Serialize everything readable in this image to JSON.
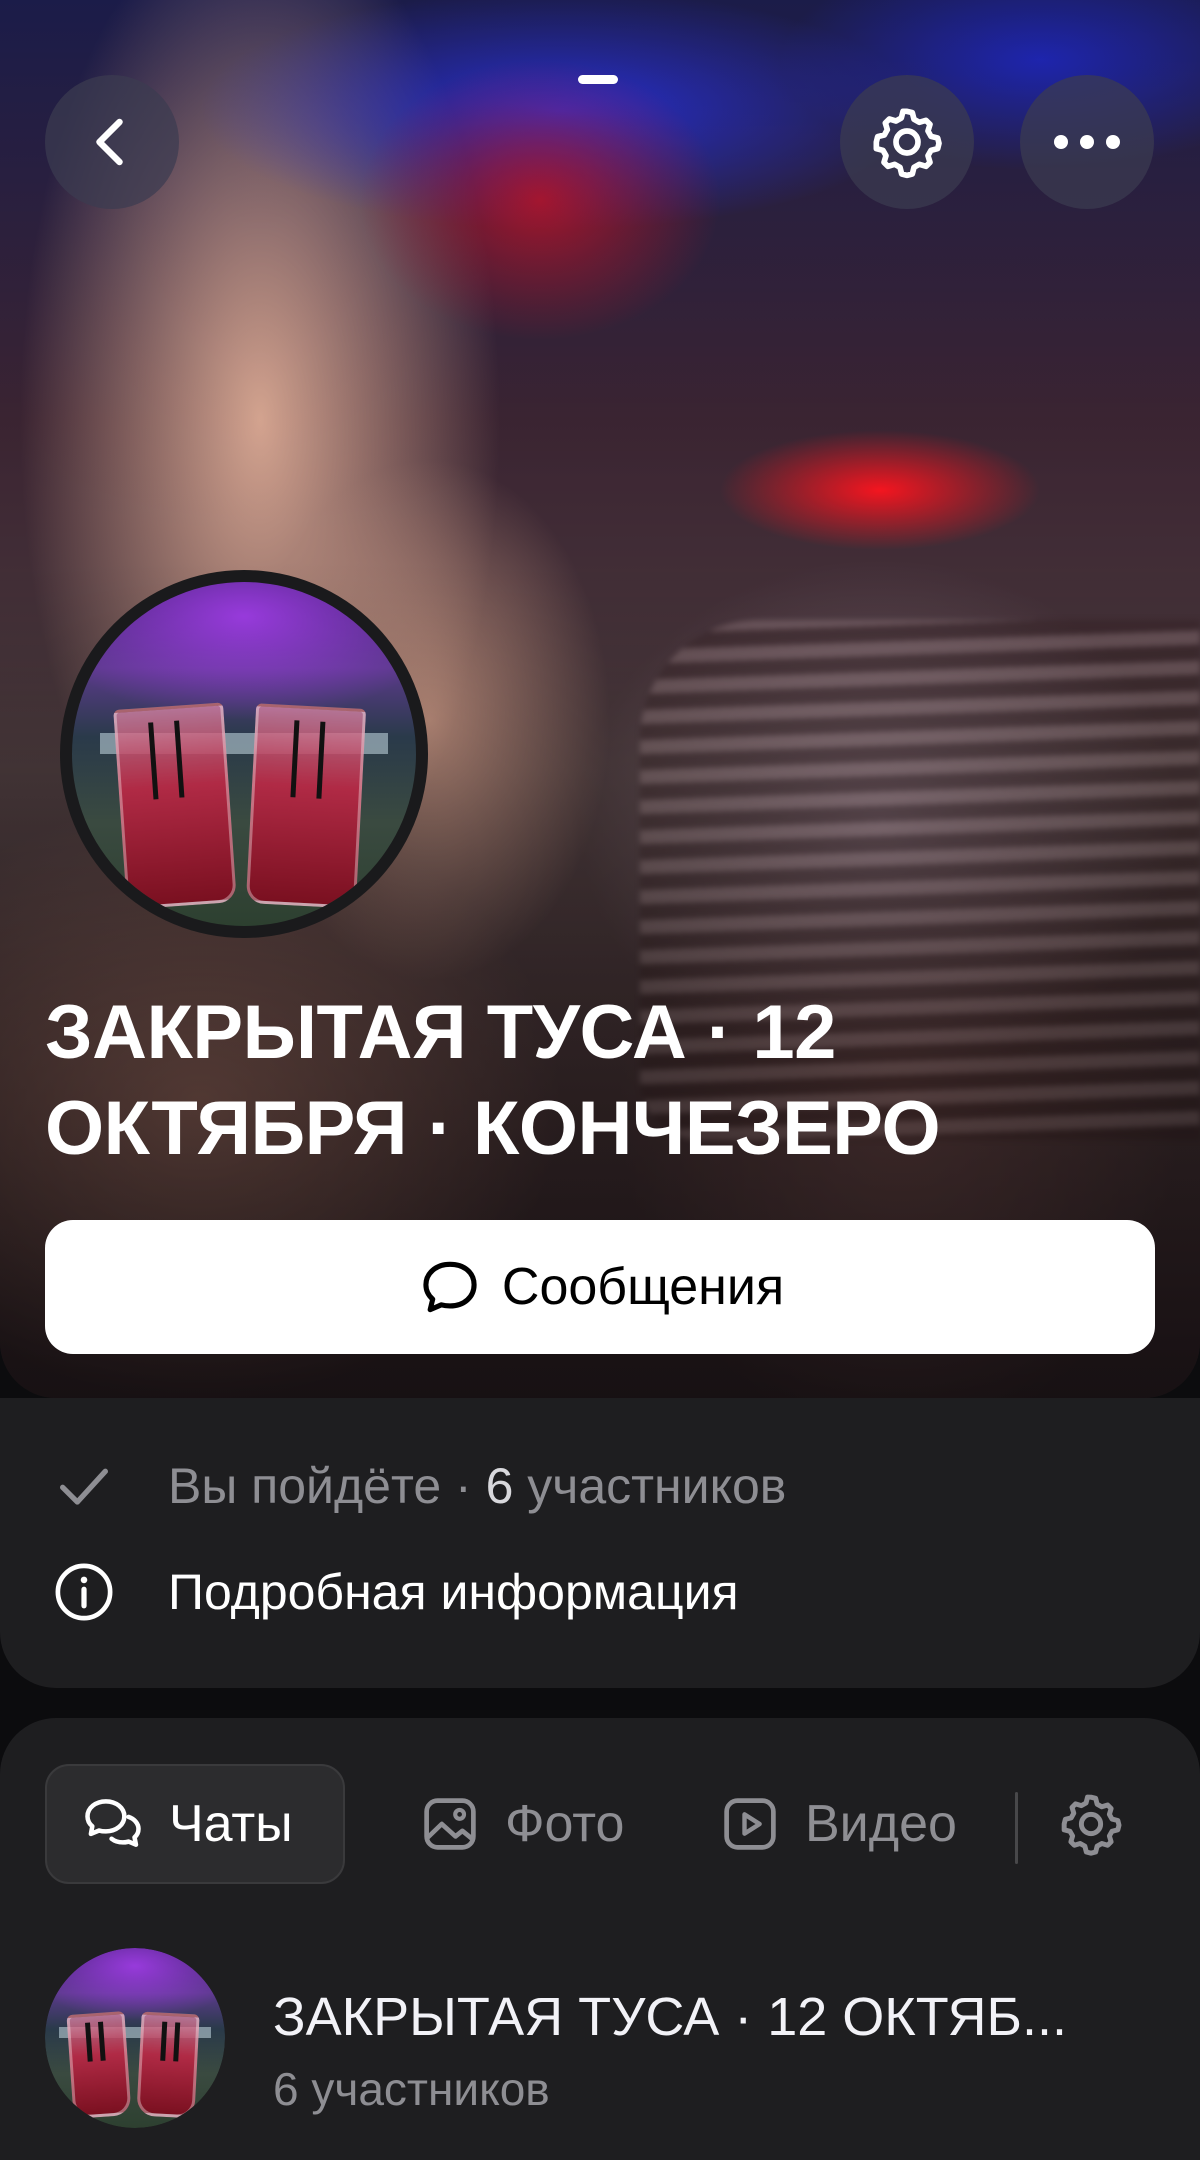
{
  "header": {
    "back_icon": "chevron-left-icon",
    "settings_icon": "gear-icon",
    "more_icon": "ellipsis-icon"
  },
  "event": {
    "title": "ЗАКРЫТАЯ ТУСА · 12 ОКТЯБРЯ · КОНЧЕЗЕРО",
    "messages_label": "Сообщения"
  },
  "info": {
    "going_text": "Вы пойдёте · ",
    "participants_count": "6",
    "participants_word": " участников",
    "details_label": "Подробная информация"
  },
  "tabs": [
    {
      "label": "Чаты",
      "icon": "chats-icon",
      "active": true
    },
    {
      "label": "Фото",
      "icon": "photo-icon",
      "active": false
    },
    {
      "label": "Видео",
      "icon": "video-icon",
      "active": false
    }
  ],
  "chat": {
    "name": "ЗАКРЫТАЯ ТУСА · 12 ОКТЯБ...",
    "meta": "6 участников"
  },
  "colors": {
    "background": "#0c0c0e",
    "card": "#1e1e20",
    "muted_text": "#8e8e93",
    "button_bg": "#ffffff"
  }
}
